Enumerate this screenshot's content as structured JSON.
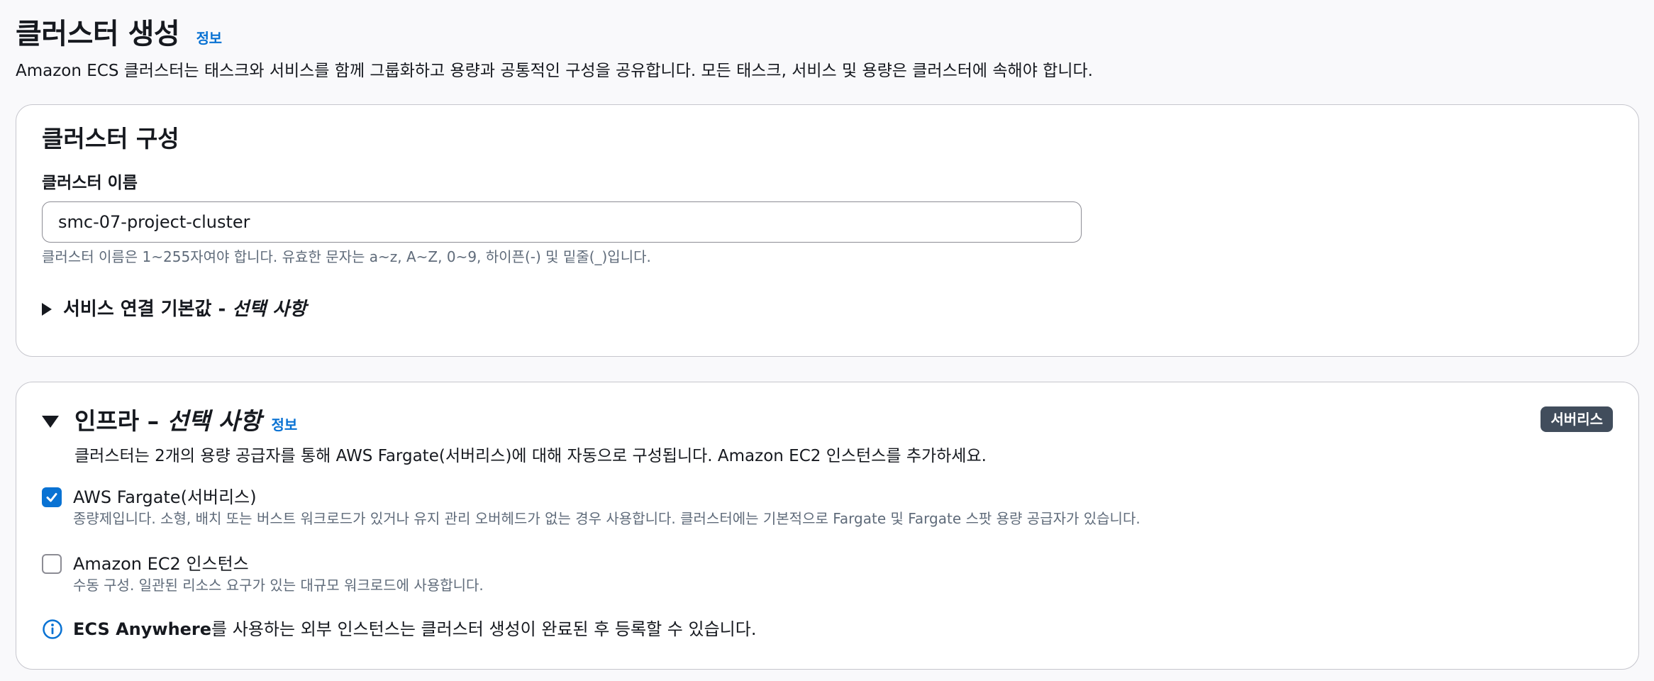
{
  "header": {
    "title": "클러스터 생성",
    "info_link": "정보",
    "description": "Amazon ECS 클러스터는 태스크와 서비스를 함께 그룹화하고 용량과 공통적인 구성을 공유합니다. 모든 태스크, 서비스 및 용량은 클러스터에 속해야 합니다."
  },
  "cluster_config": {
    "title": "클러스터 구성",
    "name_label": "클러스터 이름",
    "name_value": "smc-07-project-cluster",
    "name_constraint": "클러스터 이름은 1~255자여야 합니다. 유효한 문자는 a~z, A~Z, 0~9, 하이픈(-) 및 밑줄(_)입니다.",
    "service_connect": {
      "label": "서비스 연결 기본값 - ",
      "optional": "선택 사항",
      "expanded": false
    }
  },
  "infrastructure": {
    "title": "인프라 – ",
    "optional": "선택 사항",
    "info_link": "정보",
    "badge": "서버리스",
    "expanded": true,
    "description": "클러스터는 2개의 용량 공급자를 통해 AWS Fargate(서버리스)에 대해 자동으로 구성됩니다. Amazon EC2 인스턴스를 추가하세요.",
    "options": [
      {
        "label": "AWS Fargate(서버리스)",
        "description": "종량제입니다. 소형, 배치 또는 버스트 워크로드가 있거나 유지 관리 오버헤드가 없는 경우 사용합니다. 클러스터에는 기본적으로 Fargate 및 Fargate 스팟 용량 공급자가 있습니다.",
        "checked": true
      },
      {
        "label": "Amazon EC2 인스턴스",
        "description": "수동 구성. 일관된 리소스 요구가 있는 대규모 워크로드에 사용합니다.",
        "checked": false
      }
    ],
    "anywhere_note": {
      "bold": "ECS Anywhere",
      "text": "를 사용하는 외부 인스턴스는 클러스터 생성이 완료된 후 등록할 수 있습니다."
    }
  },
  "colors": {
    "accent": "#0972d3",
    "badge_bg": "#414d5c",
    "text": "#16191f",
    "muted": "#5f6b7a",
    "border": "#c6c6cd",
    "page_bg": "#f9f9fb"
  },
  "icons": {
    "collapsed": "caret-right-icon",
    "expanded": "caret-down-icon",
    "checked": "checkmark-icon",
    "info": "info-circle-icon"
  }
}
